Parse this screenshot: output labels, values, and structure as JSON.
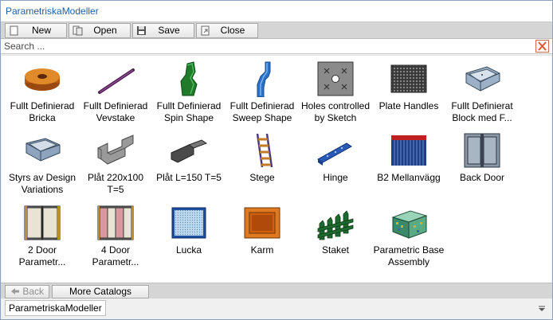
{
  "window": {
    "title": "ParametriskaModeller"
  },
  "toolbar": {
    "new_label": "New",
    "open_label": "Open",
    "save_label": "Save",
    "close_label": "Close"
  },
  "search": {
    "placeholder": "Search ..."
  },
  "items": [
    {
      "label": "Fullt Definierad Bricka",
      "icon": "washer-icon"
    },
    {
      "label": "Fullt Definierad Vevstake",
      "icon": "crank-rod-icon"
    },
    {
      "label": "Fullt Definierad Spin Shape",
      "icon": "spin-shape-icon"
    },
    {
      "label": "Fullt Definierad Sweep Shape",
      "icon": "sweep-shape-icon"
    },
    {
      "label": "Holes controlled by Sketch",
      "icon": "holes-plate-icon"
    },
    {
      "label": "Plate Handles",
      "icon": "perforated-plate-icon"
    },
    {
      "label": "Fullt Definierat Block med F...",
      "icon": "tray-block-icon"
    },
    {
      "label": "Styrs av Design Variations",
      "icon": "tray-variations-icon"
    },
    {
      "label": "Plåt 220x100 T=5",
      "icon": "sheet-profile-icon"
    },
    {
      "label": "Plåt L=150 T=5",
      "icon": "bent-plate-icon"
    },
    {
      "label": "Stege",
      "icon": "ladder-icon"
    },
    {
      "label": "Hinge",
      "icon": "hinge-icon"
    },
    {
      "label": "B2 Mellanvägg",
      "icon": "partition-wall-icon"
    },
    {
      "label": "Back Door",
      "icon": "back-door-icon"
    },
    {
      "label": "2 Door Parametr...",
      "icon": "two-door-icon"
    },
    {
      "label": "4 Door Parametr...",
      "icon": "four-door-icon"
    },
    {
      "label": "Lucka",
      "icon": "hatch-icon"
    },
    {
      "label": "Karm",
      "icon": "frame-icon"
    },
    {
      "label": "Staket",
      "icon": "fence-icon"
    },
    {
      "label": "Parametric Base Assembly",
      "icon": "base-assembly-icon"
    }
  ],
  "bottombar": {
    "back_label": "Back",
    "more_label": "More Catalogs"
  },
  "statusbar": {
    "tab_label": "ParametriskaModeller"
  }
}
